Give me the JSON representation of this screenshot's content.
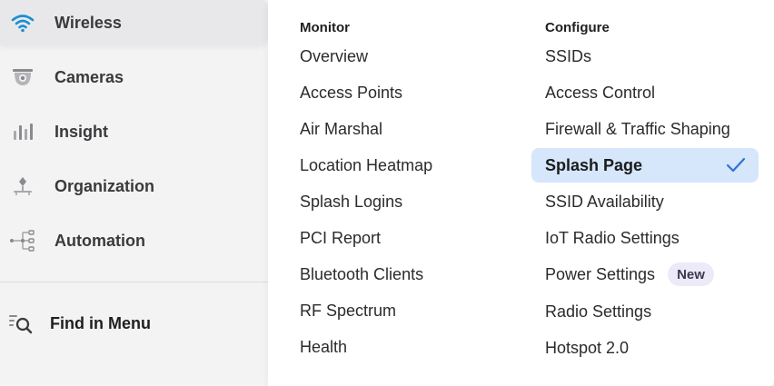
{
  "sidebar": {
    "items": [
      {
        "label": "Wireless",
        "icon": "wifi-icon",
        "active": true
      },
      {
        "label": "Cameras",
        "icon": "camera-icon",
        "active": false
      },
      {
        "label": "Insight",
        "icon": "bar-chart-icon",
        "active": false
      },
      {
        "label": "Organization",
        "icon": "organization-icon",
        "active": false
      },
      {
        "label": "Automation",
        "icon": "automation-icon",
        "active": false
      }
    ],
    "find": {
      "label": "Find in Menu",
      "icon": "find-menu-icon"
    }
  },
  "menu": {
    "monitor": {
      "title": "Monitor",
      "items": [
        "Overview",
        "Access Points",
        "Air Marshal",
        "Location Heatmap",
        "Splash Logins",
        "PCI Report",
        "Bluetooth Clients",
        "RF Spectrum",
        "Health"
      ]
    },
    "configure": {
      "title": "Configure",
      "items": [
        "SSIDs",
        "Access Control",
        "Firewall & Traffic Shaping",
        "Splash Page",
        "SSID Availability",
        "IoT Radio Settings",
        "Power Settings",
        "Radio Settings",
        "Hotspot 2.0"
      ],
      "selected": "Splash Page",
      "power_badge": "New"
    }
  },
  "colors": {
    "accent": "#1a8fd1",
    "selected_bg": "#d6e6fb",
    "check": "#2f74d0",
    "icon_gray": "#8a8a8e",
    "badge_bg": "#eceaf8"
  }
}
